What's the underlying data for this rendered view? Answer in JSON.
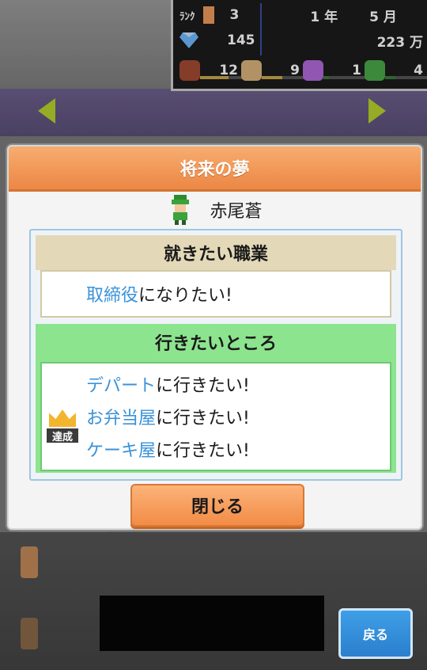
{
  "hud": {
    "rank_label": "ﾗﾝｸ",
    "rank_value": "3",
    "year": "1 年",
    "month": "5 月",
    "gems": "145",
    "money": "223 万",
    "stats": [
      {
        "icon": "food-icon",
        "value": "12",
        "bar": 0.55,
        "color": "#c9a64a"
      },
      {
        "icon": "muscle-icon",
        "value": "9",
        "bar": 0.4,
        "color": "#c9a64a"
      },
      {
        "icon": "music-icon",
        "value": "1",
        "bar": 0.1,
        "color": "#3a7a3a"
      },
      {
        "icon": "book-icon",
        "value": "4",
        "bar": 0.2,
        "color": "#3a7a3a"
      }
    ]
  },
  "dialog": {
    "title": "将来の夢",
    "character_name": "赤尾蒼",
    "job_section": {
      "heading": "就きたい職業",
      "highlight": "取締役",
      "suffix": "になりたい!"
    },
    "places_section": {
      "heading": "行きたいところ",
      "achieved_label": "達成",
      "wishes": [
        {
          "place": "デパート",
          "suffix": "に行きたい!"
        },
        {
          "place": "お弁当屋",
          "suffix": "に行きたい!"
        },
        {
          "place": "ケーキ屋",
          "suffix": "に行きたい!"
        }
      ]
    },
    "close_label": "閉じる"
  },
  "back_label": "戻る",
  "colors": {
    "accent_orange": "#ec8744",
    "link_blue": "#3a92d8",
    "section_green": "#8de48f",
    "section_tan": "#e3d9b9"
  }
}
